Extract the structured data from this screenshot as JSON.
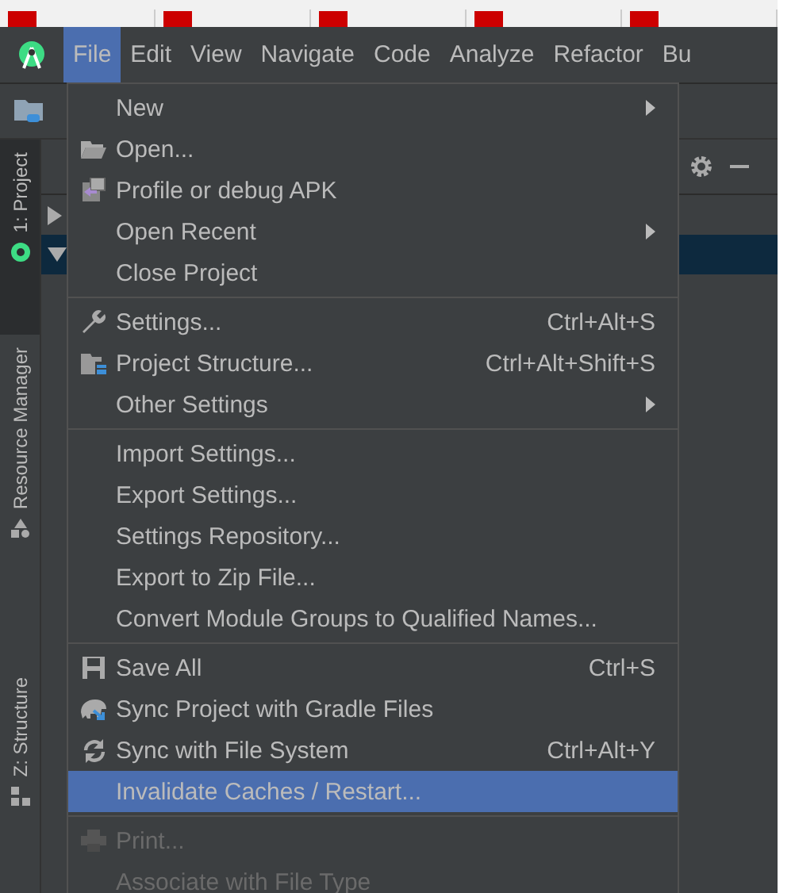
{
  "menu_bar": [
    {
      "label": "File",
      "selected": true
    },
    {
      "label": "Edit",
      "selected": false
    },
    {
      "label": "View",
      "selected": false
    },
    {
      "label": "Navigate",
      "selected": false
    },
    {
      "label": "Code",
      "selected": false
    },
    {
      "label": "Analyze",
      "selected": false
    },
    {
      "label": "Refactor",
      "selected": false
    },
    {
      "label": "Bu",
      "selected": false
    }
  ],
  "tool_windows": [
    {
      "label": "1: Project",
      "selected": true
    },
    {
      "label": "Resource Manager",
      "selected": false
    },
    {
      "label": "Z: Structure",
      "selected": false
    }
  ],
  "file_menu": [
    {
      "kind": "item",
      "label": "New",
      "submenu": true,
      "selected": false,
      "disabled": false
    },
    {
      "kind": "item",
      "label": "Open...",
      "selected": false,
      "disabled": false
    },
    {
      "kind": "item",
      "label": "Profile or debug APK",
      "selected": false,
      "disabled": false
    },
    {
      "kind": "item",
      "label": "Open Recent",
      "submenu": true,
      "selected": false,
      "disabled": false
    },
    {
      "kind": "item",
      "label": "Close Project",
      "selected": false,
      "disabled": false
    },
    {
      "kind": "separator"
    },
    {
      "kind": "item",
      "label": "Settings...",
      "shortcut": "Ctrl+Alt+S",
      "selected": false,
      "disabled": false
    },
    {
      "kind": "item",
      "label": "Project Structure...",
      "shortcut": "Ctrl+Alt+Shift+S",
      "selected": false,
      "disabled": false
    },
    {
      "kind": "item",
      "label": "Other Settings",
      "submenu": true,
      "selected": false,
      "disabled": false
    },
    {
      "kind": "separator"
    },
    {
      "kind": "item",
      "label": "Import Settings...",
      "selected": false,
      "disabled": false
    },
    {
      "kind": "item",
      "label": "Export Settings...",
      "selected": false,
      "disabled": false
    },
    {
      "kind": "item",
      "label": "Settings Repository...",
      "selected": false,
      "disabled": false
    },
    {
      "kind": "item",
      "label": "Export to Zip File...",
      "selected": false,
      "disabled": false
    },
    {
      "kind": "item",
      "label": "Convert Module Groups to Qualified Names...",
      "selected": false,
      "disabled": false
    },
    {
      "kind": "separator"
    },
    {
      "kind": "item",
      "label": "Save All",
      "shortcut": "Ctrl+S",
      "selected": false,
      "disabled": false
    },
    {
      "kind": "item",
      "label": "Sync Project with Gradle Files",
      "selected": false,
      "disabled": false
    },
    {
      "kind": "item",
      "label": "Sync with File System",
      "shortcut": "Ctrl+Alt+Y",
      "selected": false,
      "disabled": false
    },
    {
      "kind": "item",
      "label": "Invalidate Caches / Restart...",
      "selected": true,
      "disabled": false
    },
    {
      "kind": "separator"
    },
    {
      "kind": "item",
      "label": "Print...",
      "selected": false,
      "disabled": true
    },
    {
      "kind": "item",
      "label": "Associate with File Type",
      "selected": false,
      "disabled": true
    }
  ]
}
